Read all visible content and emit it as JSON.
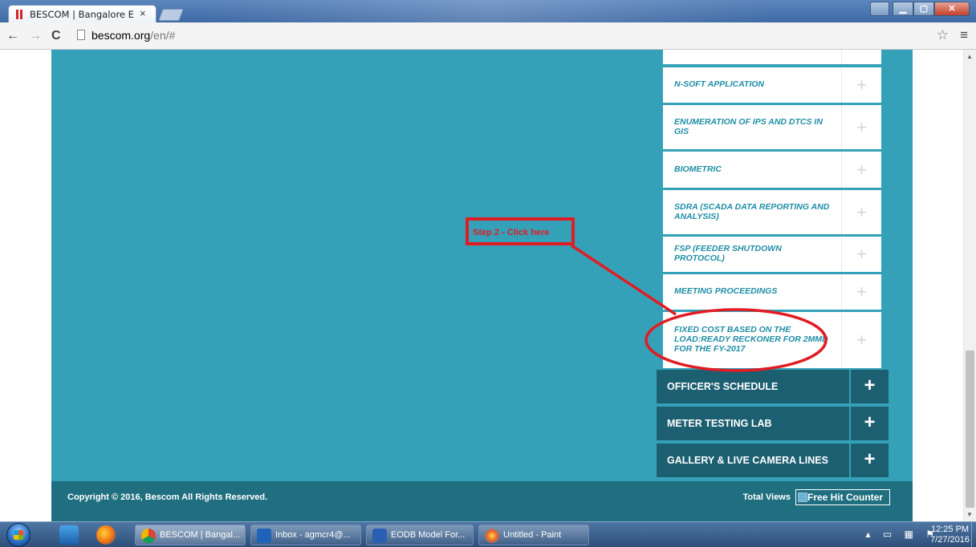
{
  "browser": {
    "tab_title": "BESCOM | Bangalore Elect",
    "tab_close": "×",
    "url_host": "bescom.org",
    "url_path": "/en/#"
  },
  "icons": {
    "back": "←",
    "forward": "→",
    "reload": "C",
    "star": "☆",
    "menu": "≡",
    "plus": "+"
  },
  "sidebar_items": [
    {
      "label": "N-SOFT APPLICATION"
    },
    {
      "label": "ENUMERATION OF IPS AND DTCS IN GIS"
    },
    {
      "label": "BIOMETRIC"
    },
    {
      "label": "SDRA (SCADA DATA REPORTING AND ANALYSIS)"
    },
    {
      "label": "FSP (FEEDER SHUTDOWN PROTOCOL)"
    },
    {
      "label": "MEETING PROCEEDINGS"
    },
    {
      "label": "FIXED COST BASED ON THE LOAD:READY RECKONER FOR 2MMD FOR THE FY-2017"
    }
  ],
  "sections": [
    {
      "label": "OFFICER'S SCHEDULE"
    },
    {
      "label": "METER TESTING LAB"
    },
    {
      "label": "GALLERY & LIVE CAMERA LINES"
    }
  ],
  "annotation": {
    "text": "Step 2 - Click here",
    "color": "#e01c24"
  },
  "footer": {
    "copyright": "Copyright © 2016, Bescom All Rights Reserved.",
    "total_views": "Total Views",
    "counter_alt": "Free Hit Counter"
  },
  "taskbar": {
    "tasks": [
      {
        "label": "BESCOM | Bangal..."
      },
      {
        "label": "Inbox - agmcr4@..."
      },
      {
        "label": "EODB Model For..."
      },
      {
        "label": "Untitled - Paint"
      }
    ],
    "time": "12:25 PM",
    "date": "7/27/2016"
  },
  "colors": {
    "page_bg": "#35a1b8",
    "footer_bg": "#1f6f80",
    "section_bg": "#1c5f71",
    "item_text": "#1f8ea6"
  }
}
